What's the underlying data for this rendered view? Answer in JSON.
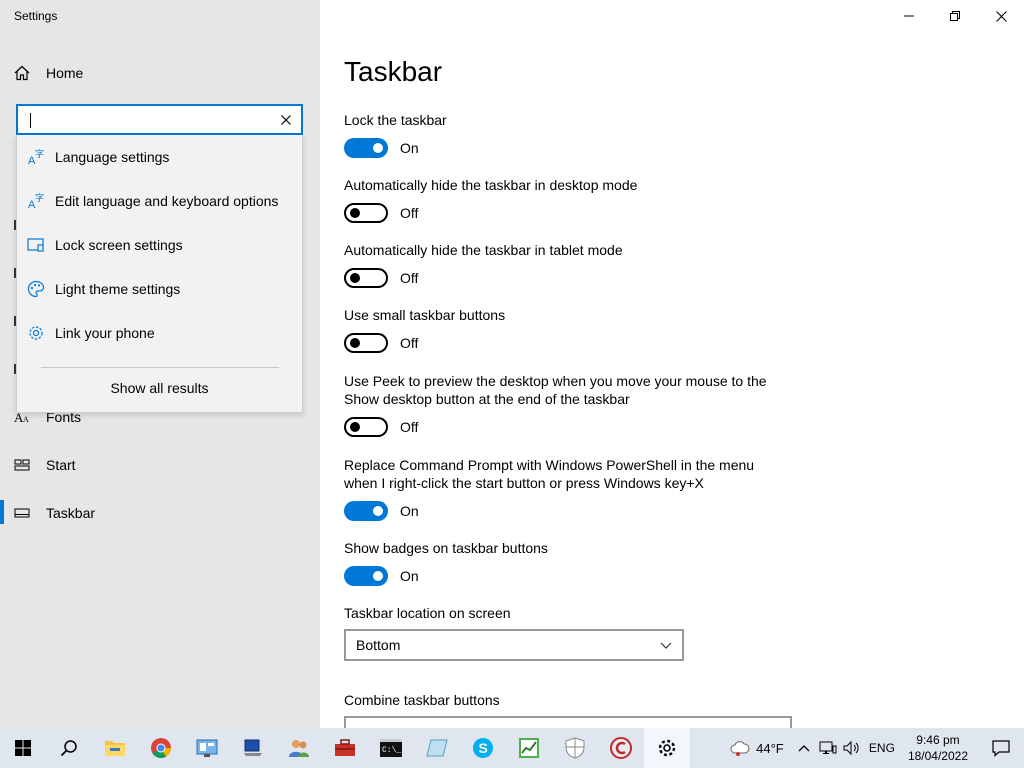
{
  "app": {
    "title": "Settings"
  },
  "nav": {
    "home_label": "Home",
    "items": [
      {
        "label": "Fonts",
        "icon": "fonts-icon"
      },
      {
        "label": "Start",
        "icon": "start-icon"
      },
      {
        "label": "Taskbar",
        "icon": "taskbar-icon",
        "active": true
      }
    ]
  },
  "search": {
    "value": "l",
    "placeholder": "",
    "suggestions": [
      {
        "label": "Language settings",
        "icon": "language-icon"
      },
      {
        "label": "Edit language and keyboard options",
        "icon": "language-icon"
      },
      {
        "label": "Lock screen settings",
        "icon": "lock-screen-icon"
      },
      {
        "label": "Light theme settings",
        "icon": "palette-icon"
      },
      {
        "label": "Link your phone",
        "icon": "gear-icon"
      }
    ],
    "show_all": "Show all results"
  },
  "page": {
    "title": "Taskbar",
    "settings": [
      {
        "label": "Lock the taskbar",
        "state": "On",
        "on": true
      },
      {
        "label": "Automatically hide the taskbar in desktop mode",
        "state": "Off",
        "on": false
      },
      {
        "label": "Automatically hide the taskbar in tablet mode",
        "state": "Off",
        "on": false
      },
      {
        "label": "Use small taskbar buttons",
        "state": "Off",
        "on": false
      },
      {
        "label": "Use Peek to preview the desktop when you move your mouse to the Show desktop button at the end of the taskbar",
        "state": "Off",
        "on": false
      },
      {
        "label": "Replace Command Prompt with Windows PowerShell in the menu when I right-click the start button or press Windows key+X",
        "state": "On",
        "on": true
      },
      {
        "label": "Show badges on taskbar buttons",
        "state": "On",
        "on": true
      }
    ],
    "location_label": "Taskbar location on screen",
    "location_value": "Bottom",
    "combine_label": "Combine taskbar buttons"
  },
  "taskbar": {
    "weather": "44°F",
    "language": "ENG",
    "time": "9:46 pm",
    "date": "18/04/2022"
  },
  "colors": {
    "accent": "#0078d7",
    "left_pane": "#e6e6e6",
    "taskbar": "#dfe6f0"
  }
}
